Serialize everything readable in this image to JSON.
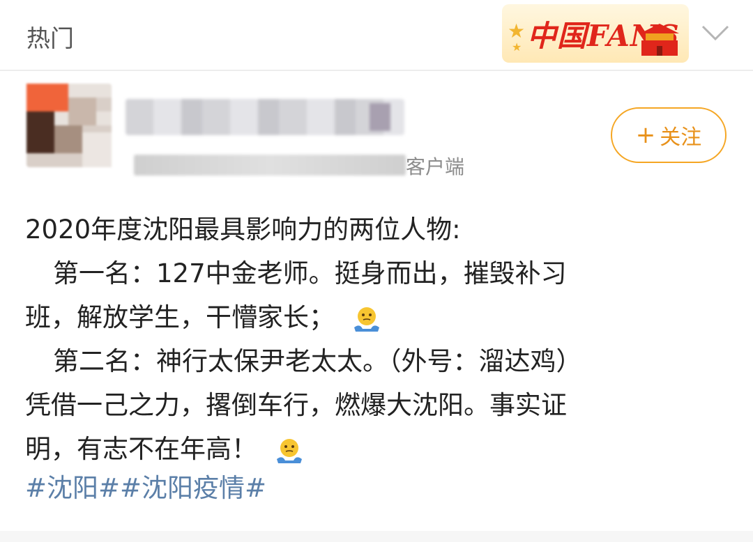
{
  "header": {
    "title": "热门",
    "badge_text": "中国FANS",
    "expand_icon": "chevron-down-icon"
  },
  "post": {
    "meta_source": "客户端",
    "follow_label": "关注",
    "follow_icon": "plus-icon",
    "lines": [
      "2020年度沈阳最具影响力的两位人物:",
      "第一名：127中金老师。挺身而出，摧毁补习",
      "班，解放学生，干懵家长；",
      "第二名：神行太保尹老太太。（外号：溜达鸡）",
      "凭借一己之力，撂倒车行，燃爆大沈阳。事实证",
      "明，有志不在年高！"
    ],
    "emoji_icon": "shrug-emoji-icon",
    "hashtags": [
      "#沈阳#",
      "#沈阳疫情#"
    ]
  },
  "colors": {
    "accent_orange": "#f5a623",
    "hashtag_blue": "#5b7fa8",
    "badge_red": "#e0261b"
  }
}
